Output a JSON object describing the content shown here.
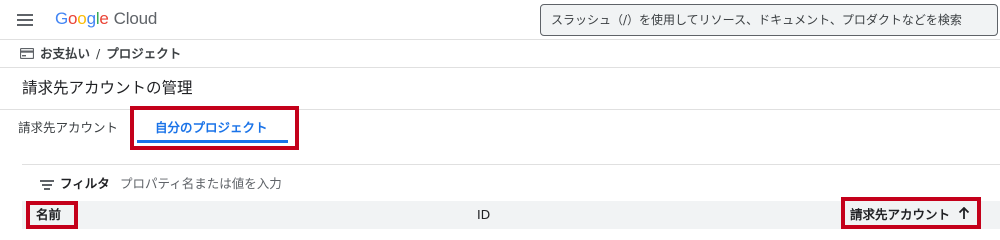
{
  "header": {
    "logo_google": "Google",
    "logo_cloud": "Cloud",
    "search_placeholder": "スラッシュ（/）を使用してリソース、ドキュメント、プロダクトなどを検索"
  },
  "breadcrumb": {
    "root": "お支払い",
    "separator": "/",
    "current": "プロジェクト"
  },
  "page": {
    "title": "請求先アカウントの管理"
  },
  "tabs": [
    {
      "label": "請求先アカウント",
      "active": false
    },
    {
      "label": "自分のプロジェクト",
      "active": true
    }
  ],
  "filter": {
    "label": "フィルタ",
    "placeholder": "プロパティ名または値を入力"
  },
  "table": {
    "columns": [
      {
        "label": "名前"
      },
      {
        "label": "ID"
      },
      {
        "label": "請求先アカウント",
        "sort": "ascending"
      }
    ]
  },
  "colors": {
    "accent": "#1a73e8",
    "highlight": "#c4001a",
    "google_blue": "#4285f4",
    "google_red": "#ea4335",
    "google_yellow": "#fbbc05",
    "google_green": "#34a853"
  },
  "icons": [
    "menu-icon",
    "billing-icon",
    "filter-icon",
    "sort-arrow-up-icon"
  ]
}
